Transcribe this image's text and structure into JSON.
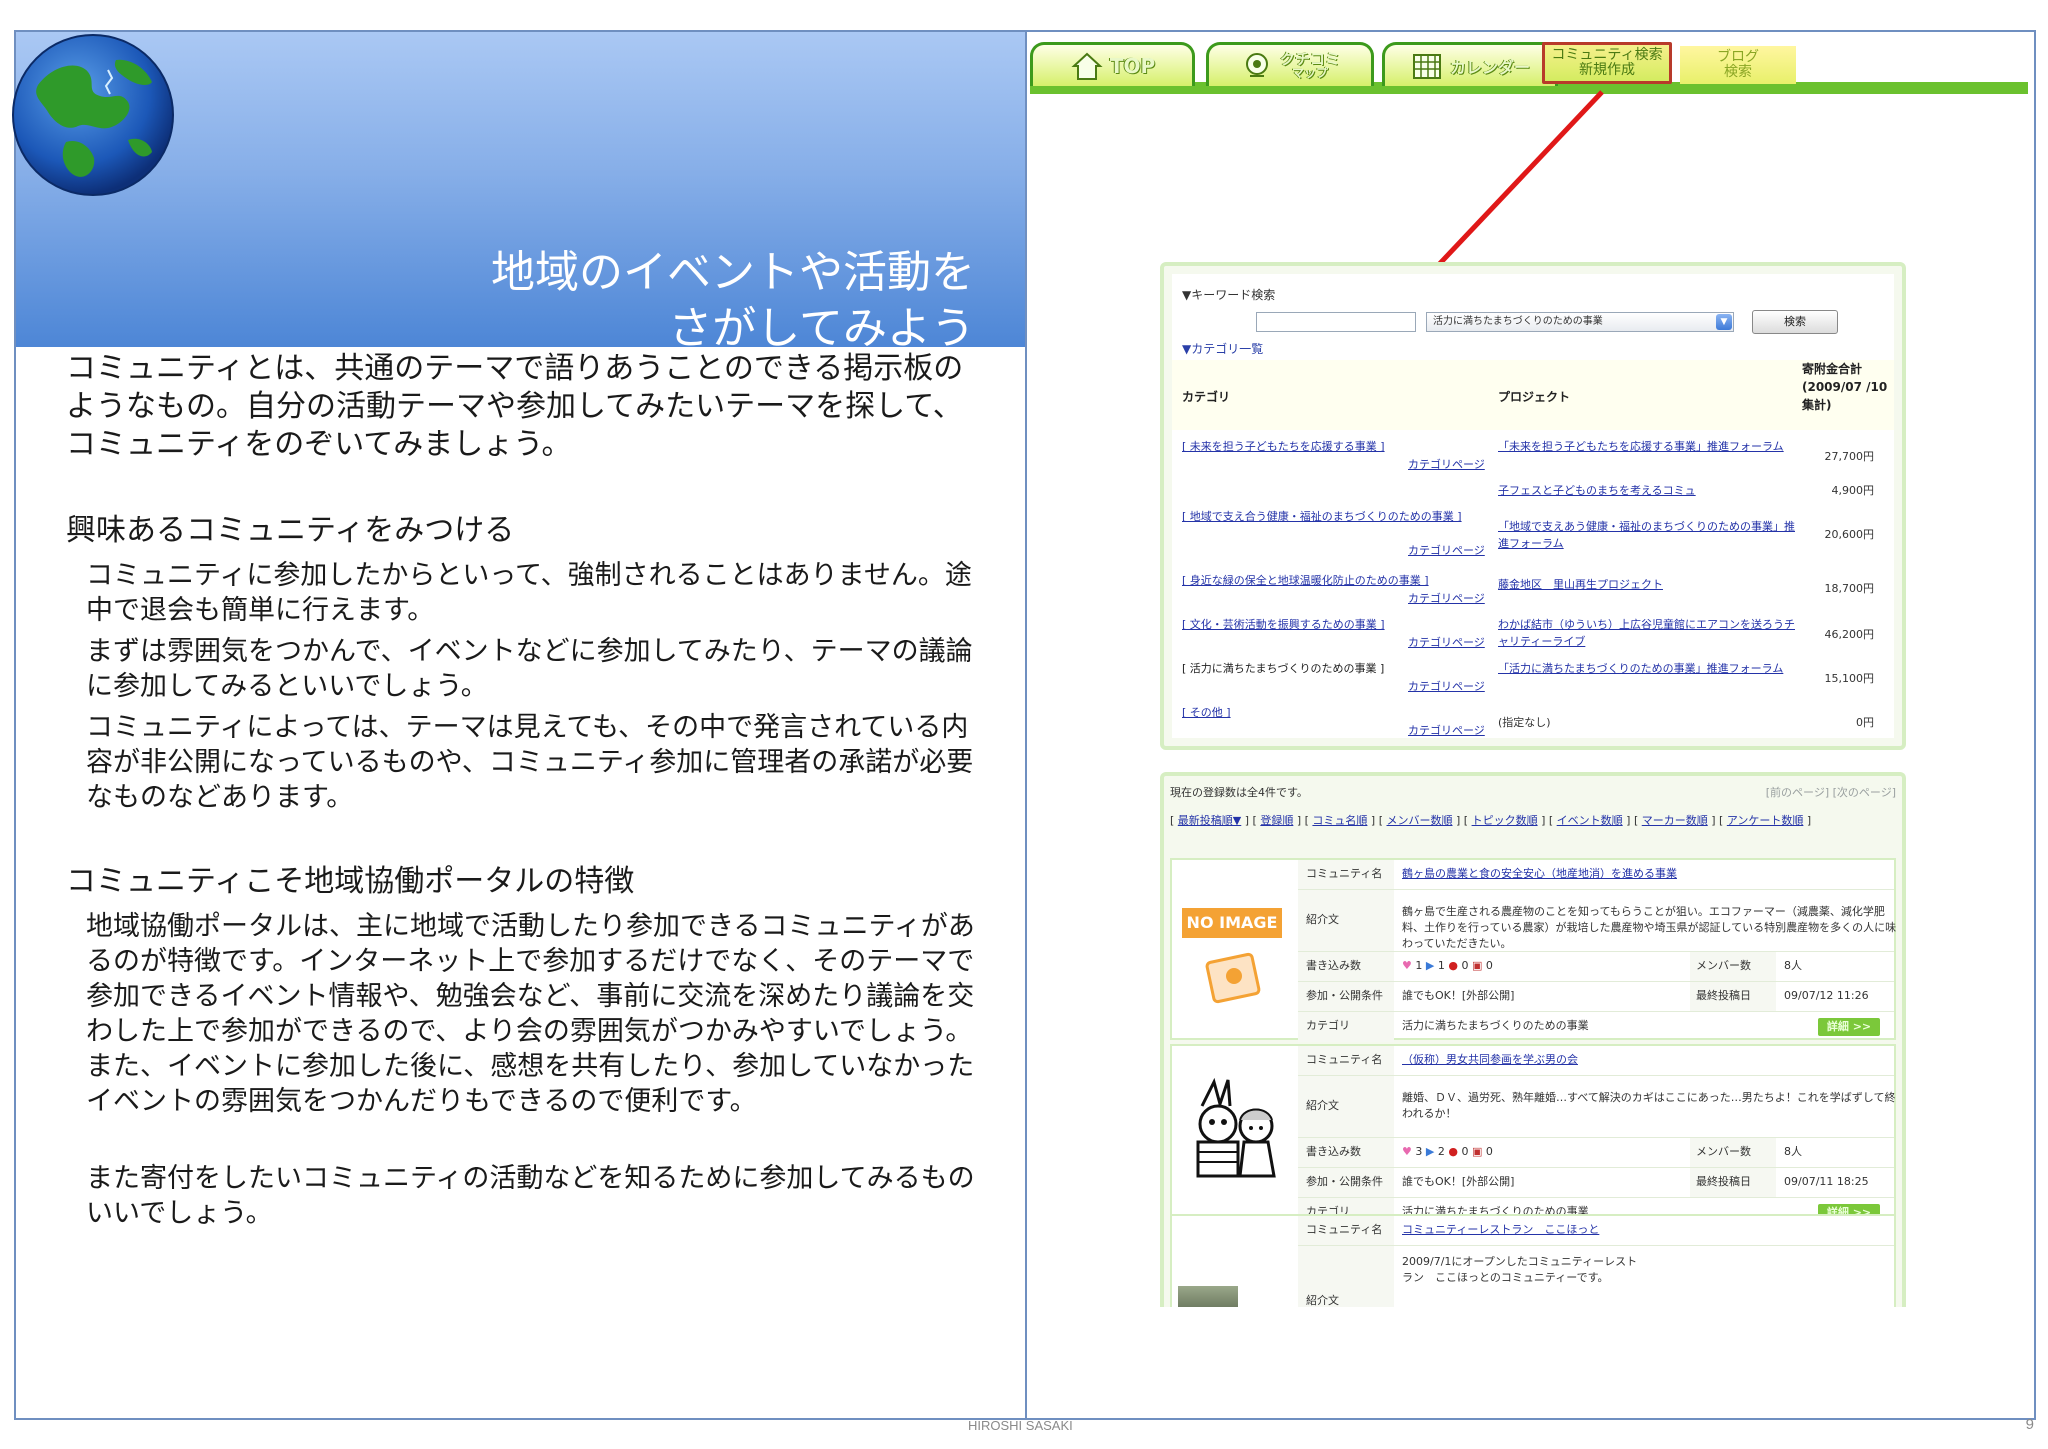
{
  "slide": {
    "title_line1": "地域のイベントや活動を",
    "title_line2": "さがしてみよう",
    "intro": "コミュニティとは、共通のテーマで語りあうことのできる掲示板のようなもの。自分の活動テーマや参加してみたいテーマを探して、コミュニティをのぞいてみましょう。",
    "section1": {
      "heading": "興味あるコミュニティをみつける",
      "paragraphs": [
        "コミュニティに参加したからといって、強制されることはありません。途中で退会も簡単に行えます。",
        "まずは雰囲気をつかんで、イベントなどに参加してみたり、テーマの議論に参加してみるといいでしょう。",
        "コミュニティによっては、テーマは見えても、その中で発言されている内容が非公開になっているものや、コミュニティ参加に管理者の承諾が必要なものなどあります。"
      ]
    },
    "section2": {
      "heading": "コミュニティこそ地域協働ポータルの特徴",
      "paragraph": "地域協働ポータルは、主に地域で活動したり参加できるコミュニティがあるのが特徴です。インターネット上で参加するだけでなく、そのテーマで参加できるイベント情報や、勉強会など、事前に交流を深めたり議論を交わした上で参加ができるので、より会の雰囲気がつかみやすいでしょう。また、イベントに参加した後に、感想を共有したり、参加していなかったイベントの雰囲気をつかんだりもできるので便利です。",
      "closing": "また寄付をしたいコミュニティの活動などを知るために参加してみるものいいでしょう。"
    },
    "footer_name": "HIROSHI SASAKI",
    "page_number": "9"
  },
  "nav": {
    "top": "TOP",
    "kuchikomi_1": "クチコミ",
    "kuchikomi_2": "マップ",
    "calendar": "カレンダー",
    "community_1": "コミュニティ検索",
    "community_2": "新規作成",
    "blog_1": "ブログ",
    "blog_2": "検索"
  },
  "search": {
    "keyword_label": "▼キーワード検索",
    "select_value": "活力に満ちたまちづくりのための事業",
    "button": "検索",
    "category_label": "▼カテゴリ一覧",
    "col_category": "カテゴリ",
    "col_project": "プロジェクト",
    "col_amount": "寄附金合計 (2009/07 /10集計)",
    "category_page_label": "カテゴリページ",
    "rows": [
      {
        "category": "[ 未来を担う子どもたちを応援する事業 ]",
        "project": "「未来を担う子どもたちを応援する事業」推進フォーラム",
        "amount": "27,700円"
      },
      {
        "category": "",
        "project": "子フェスと子どものまちを考えるコミュ",
        "amount": "4,900円"
      },
      {
        "category": "[ 地域で支え合う健康・福祉のまちづくりのための事業 ]",
        "project": "「地域で支えあう健康・福祉のまちづくりのための事業」推進フォーラム",
        "amount": "20,600円"
      },
      {
        "category": "[ 身近な緑の保全と地球温暖化防止のための事業 ]",
        "project": "藤金地区　里山再生プロジェクト",
        "amount": "18,700円"
      },
      {
        "category": "[ 文化・芸術活動を振興するための事業 ]",
        "project": "わかば結市（ゆういち）上広谷児童館にエアコンを送ろうチャリティーライブ",
        "amount": "46,200円"
      },
      {
        "category": "[ 活力に満ちたまちづくりのための事業 ]",
        "project": "「活力に満ちたまちづくりのための事業」推進フォーラム",
        "amount": "15,100円"
      },
      {
        "category": "[ その他 ]",
        "project": "(指定なし)",
        "amount": "0円"
      }
    ]
  },
  "list": {
    "count_text": "現在の登録数は全4件です。",
    "pager": "[前のページ] [次のページ]",
    "sort_items": [
      "最新投稿順▼",
      "登録順",
      "コミュ名順",
      "メンバー数順",
      "トピック数順",
      "イベント数順",
      "マーカー数順",
      "アンケート数順"
    ],
    "labels": {
      "name": "コミュニティ名",
      "intro": "紹介文",
      "posts": "書き込み数",
      "members": "メンバー数",
      "conditions": "参加・公開条件",
      "last_post": "最終投稿日",
      "category": "カテゴリ",
      "detail": "詳細 >>"
    },
    "no_image": "NO IMAGE",
    "cards": [
      {
        "name": "鶴ヶ島の農業と食の安全安心（地産地消）を進める事業",
        "intro": "鶴ヶ島で生産される農産物のことを知ってもらうことが狙い。エコファーマー（減農薬、減化学肥料、土作りを行っている農家）が栽培した農産物や埼玉県が認証している特別農産物を多くの人に味わっていただきたい。",
        "stat_heart": "1",
        "stat_flag": "1",
        "stat_pin": "0",
        "stat_note": "0",
        "members": "8人",
        "conditions": "誰でもOK！[外部公開]",
        "last_post": "09/07/12 11:26",
        "category": "活力に満ちたまちづくりのための事業"
      },
      {
        "name": "（仮称）男女共同参画を学ぶ男の会",
        "intro": "離婚、ＤＶ、過労死、熟年離婚…すべて解決のカギはここにあった…男たちよ！これを学ばずして終われるか！",
        "stat_heart": "3",
        "stat_flag": "2",
        "stat_pin": "0",
        "stat_note": "0",
        "members": "8人",
        "conditions": "誰でもOK！[外部公開]",
        "last_post": "09/07/11 18:25",
        "category": "活力に満ちたまちづくりのための事業"
      },
      {
        "name": "コミュニティーレストラン　ここほっと",
        "intro": "2009/7/1にオープンしたコミュニティーレストラン　ここほっとのコミュニティーです。"
      }
    ]
  },
  "colors": {
    "frame": "#6f8fc0",
    "title_band_top": "#aac8f4",
    "title_band_bottom": "#4d86d6",
    "nav_green": "#6bc12e",
    "highlight_red": "#b83a2a",
    "arrow": "#e01818",
    "link_blue": "#2433a8"
  }
}
